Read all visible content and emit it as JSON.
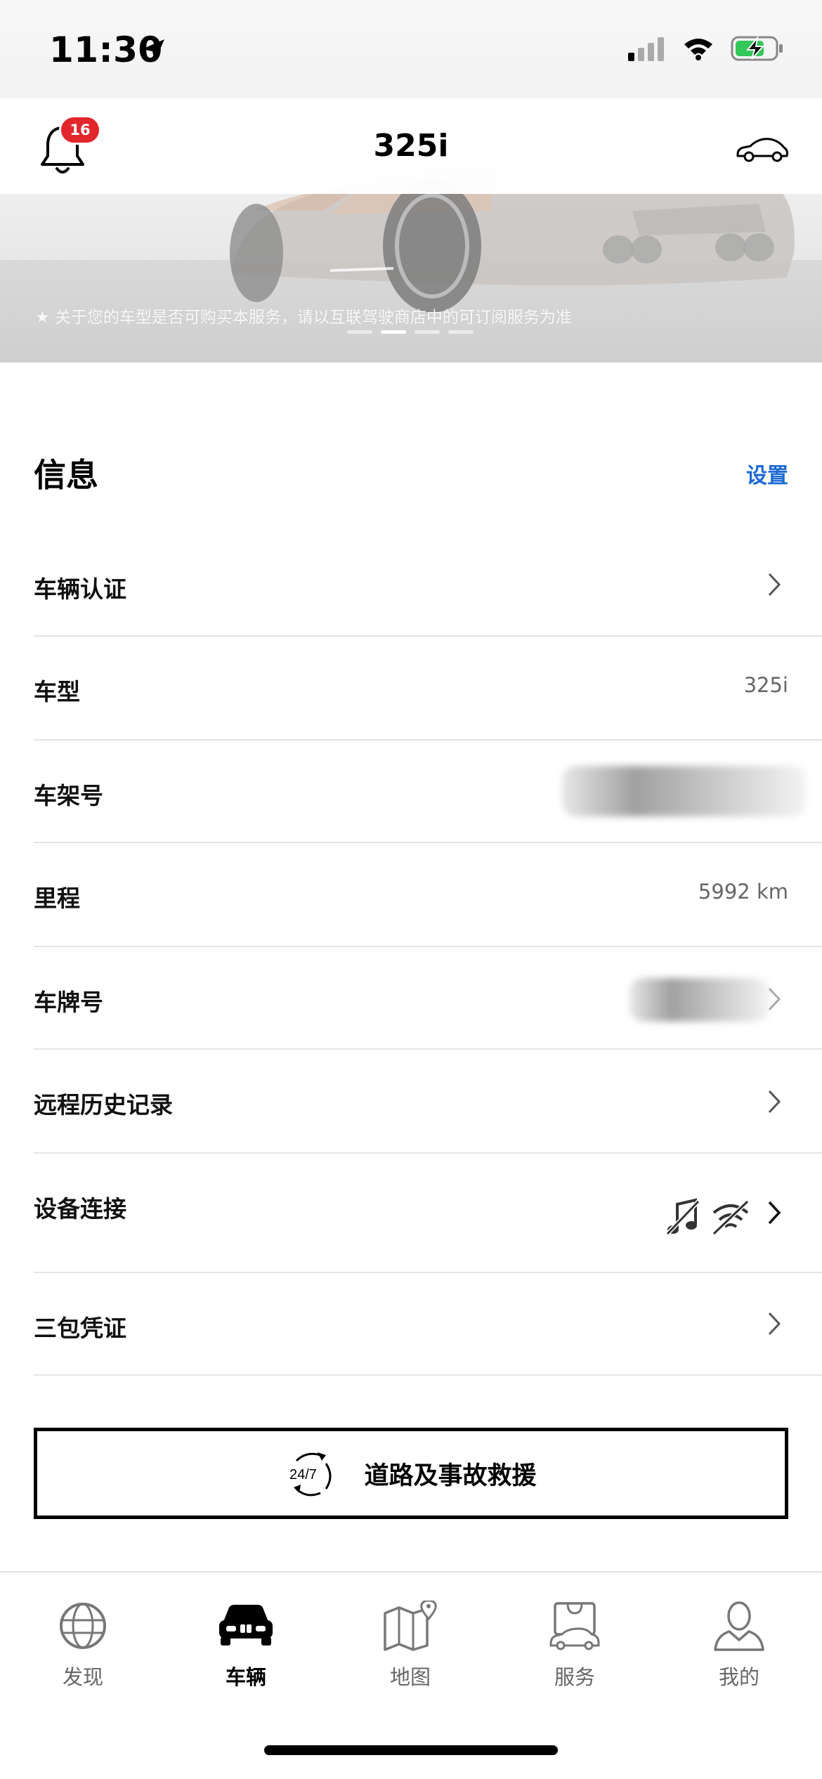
{
  "status_bar": {
    "time": "11:30"
  },
  "header": {
    "title": "325i",
    "notification_count": "16"
  },
  "hero": {
    "note": "★ 关于您的车型是否可购买本服务，请以互联驾驶商店中的可订阅服务为准",
    "dots": 4,
    "active_dot_index": 1
  },
  "info": {
    "heading": "信息",
    "settings_label": "设置",
    "rows": {
      "certification": {
        "label": "车辆认证"
      },
      "model": {
        "label": "车型",
        "value": "325i"
      },
      "vin": {
        "label": "车架号"
      },
      "mileage": {
        "label": "里程",
        "value": "5992 km"
      },
      "plate": {
        "label": "车牌号"
      },
      "remote_history": {
        "label": "远程历史记录"
      },
      "device_connection": {
        "label": "设备连接"
      },
      "warranty": {
        "label": "三包凭证"
      }
    }
  },
  "rescue": {
    "label": "道路及事故救援",
    "icon_text": "24/7"
  },
  "tabs": {
    "discover": "发现",
    "vehicle": "车辆",
    "map": "地图",
    "services": "服务",
    "mine": "我的"
  },
  "colors": {
    "accent": "#1c69d4",
    "badge": "#e1262c",
    "battery": "#34c759"
  }
}
